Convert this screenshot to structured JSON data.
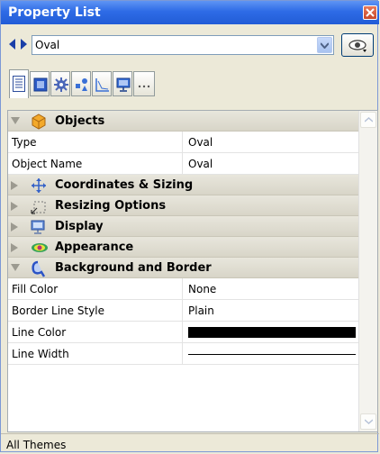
{
  "window": {
    "title": "Property List"
  },
  "selector": {
    "value": "Oval"
  },
  "tabs": [
    {
      "icon": "properties-list-icon",
      "active": true
    },
    {
      "icon": "page-icon"
    },
    {
      "icon": "gear-icon"
    },
    {
      "icon": "shapes-icon"
    },
    {
      "icon": "chart-axes-icon"
    },
    {
      "icon": "monitor-icon"
    },
    {
      "icon": "more-icon",
      "label": "···"
    }
  ],
  "categories": {
    "objects": {
      "label": "Objects",
      "expanded": true
    },
    "coordinates": {
      "label": "Coordinates & Sizing",
      "expanded": false
    },
    "resizing": {
      "label": "Resizing Options",
      "expanded": false
    },
    "display": {
      "label": "Display",
      "expanded": false
    },
    "appearance": {
      "label": "Appearance",
      "expanded": false
    },
    "background": {
      "label": "Background and Border",
      "expanded": true
    }
  },
  "properties": {
    "type": {
      "name": "Type",
      "value": "Oval"
    },
    "object_name": {
      "name": "Object Name",
      "value": "Oval"
    },
    "fill_color": {
      "name": "Fill Color",
      "value": "None"
    },
    "border_line_style": {
      "name": "Border Line Style",
      "value": "Plain"
    },
    "line_color": {
      "name": "Line Color",
      "color": "#000000"
    },
    "line_width": {
      "name": "Line Width"
    }
  },
  "status": {
    "text": "All Themes"
  }
}
